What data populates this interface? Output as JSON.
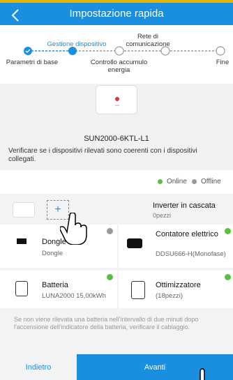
{
  "header": {
    "title": "Impostazione rapida"
  },
  "stepper": {
    "steps": [
      {
        "label": "Parametri di base"
      },
      {
        "label": "Gestione dispositivo"
      },
      {
        "label": "Controllo accumulo energia"
      },
      {
        "label": "Rete di comunicazione"
      },
      {
        "label": "Fine"
      }
    ]
  },
  "device": {
    "model": "SUN2000-6KTL-L1",
    "verify_text": "Verificare se i dispositivi rilevati sono coerenti con i dispositivi collegati."
  },
  "status": {
    "online": "Online",
    "offline": "Offline"
  },
  "cascata": {
    "label": "Inverter in cascata",
    "count": "0pezzi"
  },
  "cards": [
    {
      "title": "Dongle",
      "sub": "Dongle"
    },
    {
      "title": "Contatore elettrico",
      "sub": "DDSU666-H(Monofase)"
    },
    {
      "title": "Batteria",
      "sub": "LUNA2000 15,00kWh"
    },
    {
      "title": "Ottimizzatore",
      "sub": "(18pezzi)"
    }
  ],
  "note": "Se non viene rilevata una batteria nell'intervallo di due minuti dopo l'accensione dell'indicatore della batteria, verificare il cablaggio.",
  "footer": {
    "back": "Indietro",
    "next": "Avanti"
  },
  "colors": {
    "accent": "#1a8fe0",
    "online": "#5bbf3a",
    "offline": "#999999"
  }
}
